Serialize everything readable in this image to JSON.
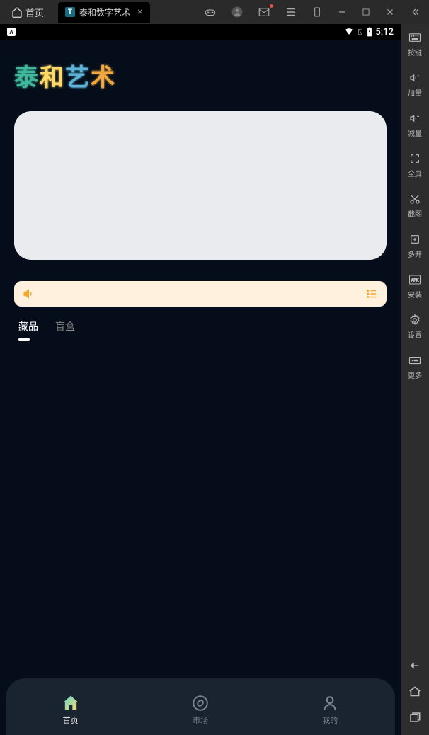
{
  "browser": {
    "home_label": "首页",
    "tab_title": "泰和数字艺术",
    "tab_letter": "T"
  },
  "status": {
    "letter": "A",
    "time": "5:12"
  },
  "app": {
    "logo_chars": [
      "泰",
      "和",
      "艺",
      "术"
    ],
    "tabs": [
      "藏品",
      "盲盒"
    ]
  },
  "bottom_nav": {
    "home": "首页",
    "market": "市场",
    "mine": "我的"
  },
  "sidebar": {
    "keyboard": "按键",
    "vol_up": "加量",
    "vol_down": "减量",
    "fullscreen": "全屏",
    "screenshot": "截图",
    "multi": "多开",
    "install": "安装",
    "settings": "设置",
    "more": "更多"
  }
}
